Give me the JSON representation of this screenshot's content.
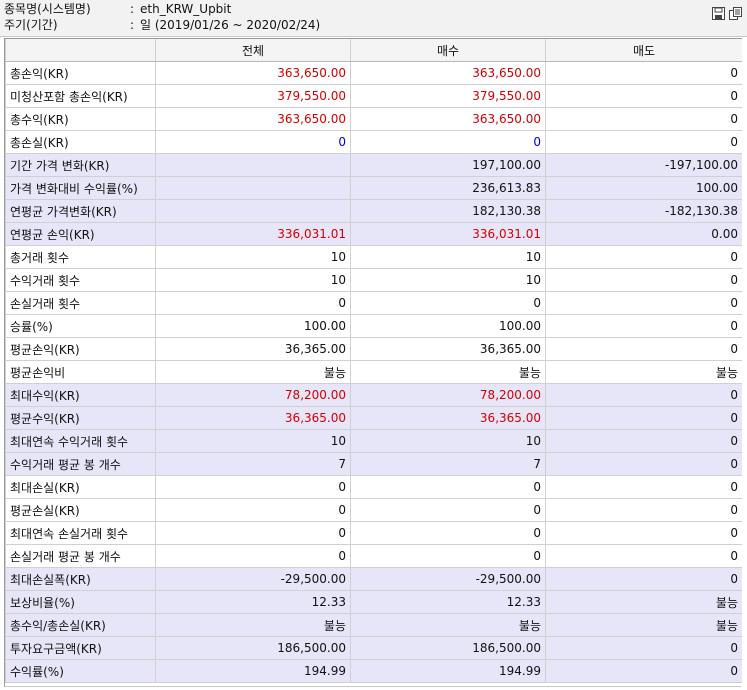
{
  "header": {
    "system_label": "종목명(시스템명)",
    "system_value": "eth_KRW_Upbit",
    "period_label": "주기(기간)",
    "period_value": "일 (2019/01/26 ~ 2020/02/24)",
    "colon": ":"
  },
  "icons": {
    "save": "save-icon",
    "copy": "copy-icon"
  },
  "colors": {
    "shaded_row": "#e6e6f8",
    "profit_red": "#d40000",
    "loss_blue": "#0000e0"
  },
  "table": {
    "columns": [
      "",
      "전체",
      "매수",
      "매도"
    ],
    "rows": [
      {
        "label": "총손익(KR)",
        "total": "363,650.00",
        "buy": "363,650.00",
        "sell": "0",
        "shaded": false,
        "color": "red"
      },
      {
        "label": "미청산포함 총손익(KR)",
        "total": "379,550.00",
        "buy": "379,550.00",
        "sell": "0",
        "shaded": false,
        "color": "red"
      },
      {
        "label": "총수익(KR)",
        "total": "363,650.00",
        "buy": "363,650.00",
        "sell": "0",
        "shaded": false,
        "color": "red"
      },
      {
        "label": "총손실(KR)",
        "total": "0",
        "buy": "0",
        "sell": "0",
        "shaded": false,
        "color": "blue"
      },
      {
        "label": "기간 가격 변화(KR)",
        "total": "",
        "buy": "197,100.00",
        "sell": "-197,100.00",
        "shaded": true,
        "color": ""
      },
      {
        "label": "가격 변화대비 수익률(%)",
        "total": "",
        "buy": "236,613.83",
        "sell": "100.00",
        "shaded": true,
        "color": ""
      },
      {
        "label": "연평균 가격변화(KR)",
        "total": "",
        "buy": "182,130.38",
        "sell": "-182,130.38",
        "shaded": true,
        "color": ""
      },
      {
        "label": "연평균 손익(KR)",
        "total": "336,031.01",
        "buy": "336,031.01",
        "sell": "0.00",
        "shaded": true,
        "color": "red"
      },
      {
        "label": "총거래 횟수",
        "total": "10",
        "buy": "10",
        "sell": "0",
        "shaded": false,
        "color": ""
      },
      {
        "label": "수익거래 횟수",
        "total": "10",
        "buy": "10",
        "sell": "0",
        "shaded": false,
        "color": ""
      },
      {
        "label": "손실거래 횟수",
        "total": "0",
        "buy": "0",
        "sell": "0",
        "shaded": false,
        "color": ""
      },
      {
        "label": "승률(%)",
        "total": "100.00",
        "buy": "100.00",
        "sell": "0",
        "shaded": false,
        "color": ""
      },
      {
        "label": "평균손익(KR)",
        "total": "36,365.00",
        "buy": "36,365.00",
        "sell": "0",
        "shaded": false,
        "color": ""
      },
      {
        "label": "평균손익비",
        "total": "불능",
        "buy": "불능",
        "sell": "불능",
        "shaded": false,
        "color": ""
      },
      {
        "label": "최대수익(KR)",
        "total": "78,200.00",
        "buy": "78,200.00",
        "sell": "0",
        "shaded": true,
        "color": "red"
      },
      {
        "label": "평균수익(KR)",
        "total": "36,365.00",
        "buy": "36,365.00",
        "sell": "0",
        "shaded": true,
        "color": "red"
      },
      {
        "label": "최대연속 수익거래 횟수",
        "total": "10",
        "buy": "10",
        "sell": "0",
        "shaded": true,
        "color": ""
      },
      {
        "label": "수익거래 평균 봉 개수",
        "total": "7",
        "buy": "7",
        "sell": "0",
        "shaded": true,
        "color": ""
      },
      {
        "label": "최대손실(KR)",
        "total": "0",
        "buy": "0",
        "sell": "0",
        "shaded": false,
        "color": ""
      },
      {
        "label": "평균손실(KR)",
        "total": "0",
        "buy": "0",
        "sell": "0",
        "shaded": false,
        "color": ""
      },
      {
        "label": "최대연속 손실거래 횟수",
        "total": "0",
        "buy": "0",
        "sell": "0",
        "shaded": false,
        "color": ""
      },
      {
        "label": "손실거래 평균 봉 개수",
        "total": "0",
        "buy": "0",
        "sell": "0",
        "shaded": false,
        "color": ""
      },
      {
        "label": "최대손실폭(KR)",
        "total": "-29,500.00",
        "buy": "-29,500.00",
        "sell": "0",
        "shaded": true,
        "color": ""
      },
      {
        "label": "보상비율(%)",
        "total": "12.33",
        "buy": "12.33",
        "sell": "불능",
        "shaded": true,
        "color": ""
      },
      {
        "label": "총수익/총손실(KR)",
        "total": "불능",
        "buy": "불능",
        "sell": "불능",
        "shaded": true,
        "color": ""
      },
      {
        "label": "투자요구금액(KR)",
        "total": "186,500.00",
        "buy": "186,500.00",
        "sell": "0",
        "shaded": true,
        "color": ""
      },
      {
        "label": "수익률(%)",
        "total": "194.99",
        "buy": "194.99",
        "sell": "0",
        "shaded": true,
        "color": ""
      }
    ]
  }
}
